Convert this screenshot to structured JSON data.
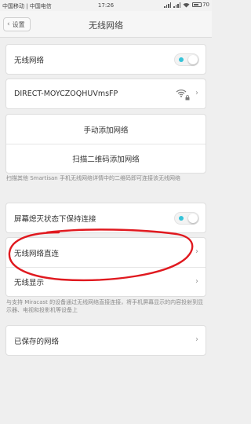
{
  "status_bar": {
    "carrier": "中国移动 | 中国电信",
    "time": "17:26",
    "battery": "70"
  },
  "nav": {
    "back_label": "设置",
    "title": "无线网络"
  },
  "wifi_toggle": {
    "label": "无线网络",
    "on": true
  },
  "network": {
    "ssid": "DIRECT-MOYCZOQHUVmsFP"
  },
  "actions": {
    "add_manual": "手动添加网络",
    "scan_qr": "扫描二维码添加网络"
  },
  "qr_note": "扫描其他 Smartisan 手机无线网络详情中的二维码即可连接该无线网络",
  "keep_on": {
    "label": "屏幕熄灭状态下保持连接",
    "on": true
  },
  "wifi_direct": {
    "label": "无线网络直连"
  },
  "wireless_display": {
    "label": "无线显示"
  },
  "miracast_note": "与支持 Miracast 的设备通过无线网络直接连接，将手机屏幕显示的内容投射到显示器、电视和投影机等设备上",
  "saved_networks": {
    "label": "已保存的网络"
  },
  "colors": {
    "accent": "#35c3d8",
    "annotation": "#e0191f"
  }
}
